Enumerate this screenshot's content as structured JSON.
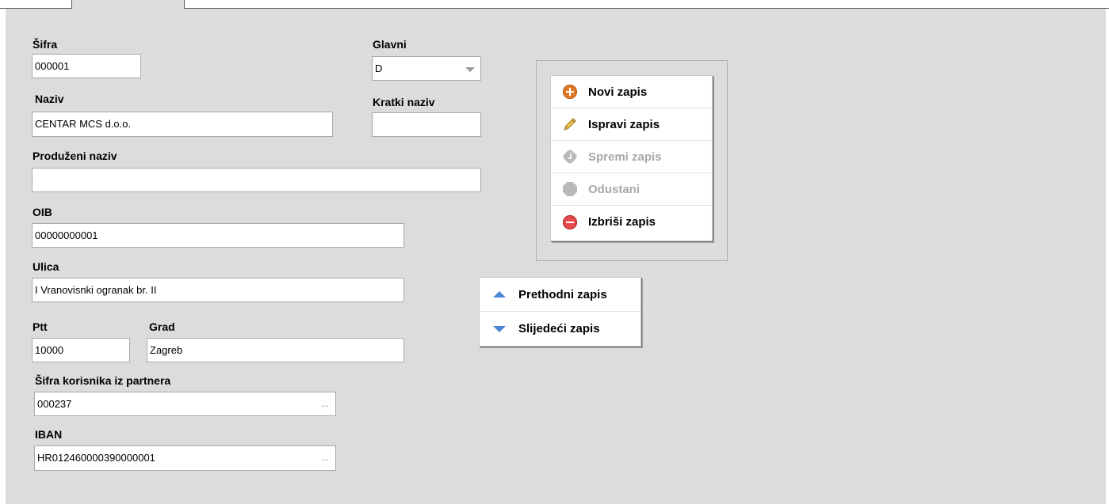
{
  "form": {
    "sifra": {
      "label": "Šifra",
      "value": "000001"
    },
    "glavni": {
      "label": "Glavni",
      "value": "D"
    },
    "naziv": {
      "label": "Naziv",
      "value": "CENTAR MCS d.o.o."
    },
    "kratki_naziv": {
      "label": "Kratki naziv",
      "value": ""
    },
    "produzeni_naziv": {
      "label": "Produženi naziv",
      "value": ""
    },
    "oib": {
      "label": "OIB",
      "value": "00000000001"
    },
    "ulica": {
      "label": "Ulica",
      "value": "I Vranovisnki ogranak br. II"
    },
    "ptt": {
      "label": "Ptt",
      "value": "10000"
    },
    "grad": {
      "label": "Grad",
      "value": "Zagreb"
    },
    "sifra_korisnika": {
      "label": "Šifra korisnika iz partnera",
      "value": "000237",
      "lookup": "..."
    },
    "iban": {
      "label": "IBAN",
      "value": "HR012460000390000001",
      "lookup": "..."
    }
  },
  "actions": {
    "new": {
      "label": "Novi zapis",
      "icon": "plus-circle-icon",
      "enabled": true
    },
    "edit": {
      "label": "Ispravi zapis",
      "icon": "pencil-icon",
      "enabled": true
    },
    "save": {
      "label": "Spremi zapis",
      "icon": "check-icon",
      "enabled": false
    },
    "cancel": {
      "label": "Odustani",
      "icon": "stop-icon",
      "enabled": false
    },
    "delete": {
      "label": "Izbriši zapis",
      "icon": "minus-circle-icon",
      "enabled": true
    }
  },
  "navigation": {
    "prev": {
      "label": "Prethodni zapis",
      "icon": "triangle-up-icon"
    },
    "next": {
      "label": "Slijedeći zapis",
      "icon": "triangle-down-icon"
    }
  },
  "colors": {
    "panel_bg": "#dcdcdc",
    "accent_orange": "#e07a28",
    "accent_red": "#e34a4a",
    "accent_blue": "#4a86d2",
    "disabled_text": "#a8a8a8"
  }
}
